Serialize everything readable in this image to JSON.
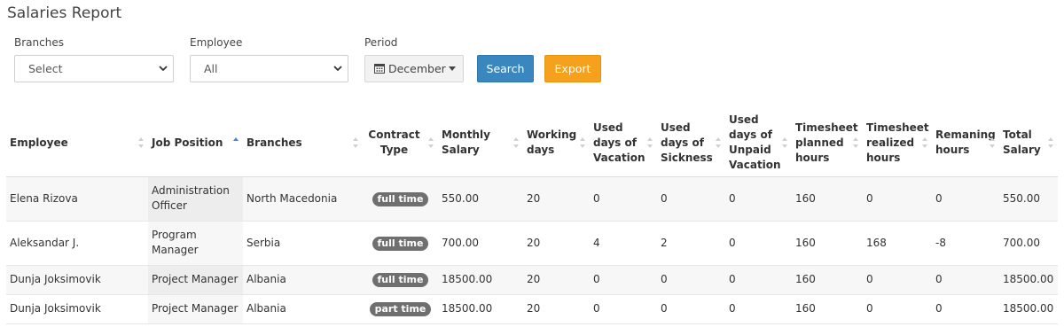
{
  "page": {
    "title": "Salaries Report"
  },
  "filters": {
    "branches_label": "Branches",
    "branches_value": "Select",
    "employee_label": "Employee",
    "employee_value": "All",
    "period_label": "Period",
    "period_value": "December",
    "search_label": "Search",
    "export_label": "Export"
  },
  "colors": {
    "search": "#3a87bf",
    "export": "#f5a11d",
    "badge": "#6f6f6f"
  },
  "table": {
    "headers": [
      "Employee",
      "Job Position",
      "Branches",
      "Contract Type",
      "Monthly Salary",
      "Working days",
      "Used days of Vacation",
      "Used days of Sickness",
      "Used days of Unpaid Vacation",
      "Timesheet planned hours",
      "Timesheet realized hours",
      "Remaning hours",
      "Total Salary"
    ],
    "sorted_column": "Job Position",
    "sort_direction": "ascending",
    "rows": [
      [
        "Elena Rizova",
        "Administration Officer",
        "North Macedonia",
        "full time",
        "550.00",
        "20",
        "0",
        "0",
        "0",
        "160",
        "0",
        "0",
        "550.00"
      ],
      [
        "Aleksandar J.",
        "Program Manager",
        "Serbia",
        "full time",
        "700.00",
        "20",
        "4",
        "2",
        "0",
        "160",
        "168",
        "-8",
        "700.00"
      ],
      [
        "Dunja Joksimovik",
        "Project Manager",
        "Albania",
        "full time",
        "18500.00",
        "20",
        "0",
        "0",
        "0",
        "160",
        "0",
        "0",
        "18500.00"
      ],
      [
        "Dunja Joksimovik",
        "Project Manager",
        "Albania",
        "part time",
        "18500.00",
        "20",
        "0",
        "0",
        "0",
        "160",
        "0",
        "0",
        "18500.00"
      ]
    ]
  }
}
